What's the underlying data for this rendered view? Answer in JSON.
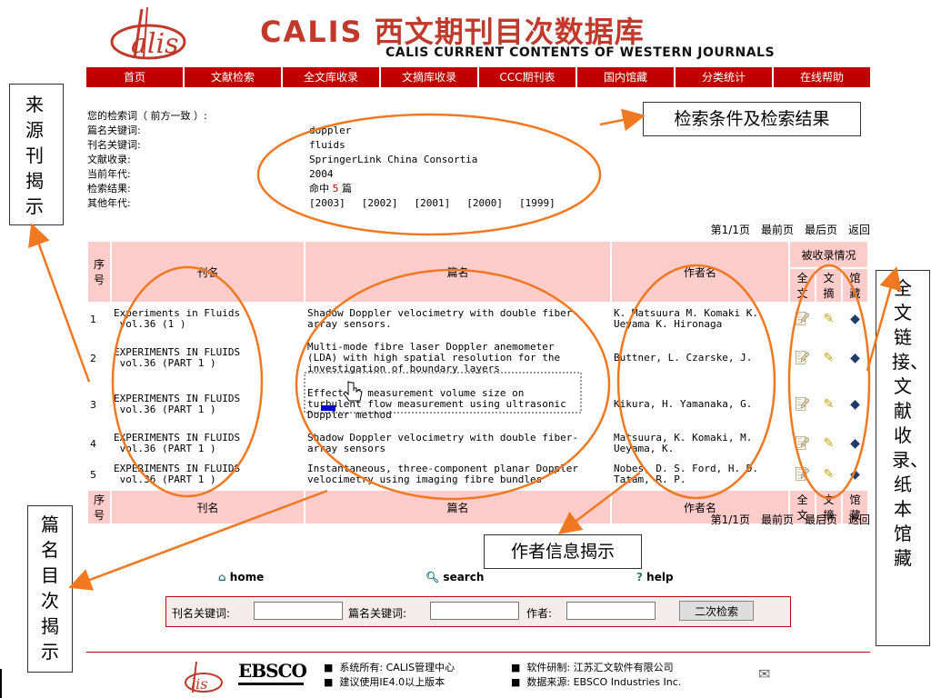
{
  "header": {
    "title_cn_latin": "CALIS",
    "title_cn": "西文期刊目次数据库",
    "title_en": "CALIS CURRENT CONTENTS OF WESTERN JOURNALS"
  },
  "nav": [
    "首页",
    "文献检索",
    "全文库收录",
    "文摘库收录",
    "CCC期刊表",
    "国内馆藏",
    "分类统计",
    "在线帮助"
  ],
  "search_info": {
    "header_label": "您的检索词（ 前方一致 ）:",
    "rows": [
      {
        "label": "篇名关键词:",
        "value": "doppler"
      },
      {
        "label": "刊名关键词:",
        "value": "fluids"
      },
      {
        "label": "文献收录:",
        "value": "SpringerLink China Consortia"
      },
      {
        "label": "当前年代:",
        "value": "2004"
      }
    ],
    "result_label": "检索结果:",
    "result_prefix": "命中",
    "result_count": "5",
    "result_suffix": "篇",
    "other_years_label": "其他年代:",
    "other_years": [
      "[2003]",
      "[2002]",
      "[2001]",
      "[2000]",
      "[1999]"
    ]
  },
  "pager": {
    "page": "第1/1页",
    "first": "最前页",
    "last": "最后页",
    "back": "返回"
  },
  "table": {
    "col_seq": "序号",
    "col_journal": "刊名",
    "col_title": "篇名",
    "col_author": "作者名",
    "col_holdings": "被收录情况",
    "col_full": "全文",
    "col_abs": "文摘",
    "col_lib": "馆藏",
    "rows": [
      {
        "no": "1",
        "journal": "Experiments in Fluids\n vol.36 (1 )",
        "title": "Shadow Doppler velocimetry with double fiber-\narray sensors.",
        "author": "K. Matsuura M. Komaki K.\nUeyama K. Hironaga"
      },
      {
        "no": "2",
        "journal": "EXPERIMENTS IN FLUIDS\n vol.36 (PART 1 )",
        "title": "Multi-mode fibre laser Doppler anemometer\n(LDA) with high spatial resolution for the\ninvestigation of boundary layers",
        "author": "Buttner, L. Czarske, J."
      },
      {
        "no": "3",
        "journal": "EXPERIMENTS IN FLUIDS\n vol.36 (PART 1 )",
        "title": "Effect of measurement volume size on\nturbulent flow measurement using ultrasonic\nDoppler method",
        "author": "Kikura, H. Yamanaka, G."
      },
      {
        "no": "4",
        "journal": "EXPERIMENTS IN FLUIDS\n vol.36 (PART 1 )",
        "title": "Shadow Doppler velocimetry with double fiber-\narray sensors",
        "author": "Matsuura, K. Komaki, M.\nUeyama, K."
      },
      {
        "no": "5",
        "journal": "EXPERIMENTS IN FLUIDS\n vol.36 (PART 1 )",
        "title": "Instantaneous, three-component planar Doppler\nvelocimetry using imaging fibre bundles",
        "author": "Nobes, D. S. Ford, H. D.\nTatam, R. P."
      }
    ]
  },
  "links": {
    "home": "home",
    "search": "search",
    "help": "help"
  },
  "bottom_search": {
    "journal_label": "刊名关键词:",
    "title_label": "篇名关键词:",
    "author_label": "作者:",
    "button": "二次检索"
  },
  "footer": {
    "ebsco": "EBSCO",
    "line1a": "系统所有: CALIS管理中心",
    "line1b": "软件研制: 江苏汇文软件有限公司",
    "line2a": "建议使用IE4.0以上版本",
    "line2b": "数据来源: EBSCO Industries Inc."
  },
  "annotations": {
    "source": "来源刊揭示",
    "search": "检索条件及检索结果",
    "holdings": "全文链接、文献收录、纸本馆藏",
    "author": "作者信息揭示",
    "title": "篇名目次揭示"
  },
  "colors": {
    "brand_red": "#c00000",
    "header_pink": "#ffcccc",
    "annotation_orange": "#f07820"
  }
}
